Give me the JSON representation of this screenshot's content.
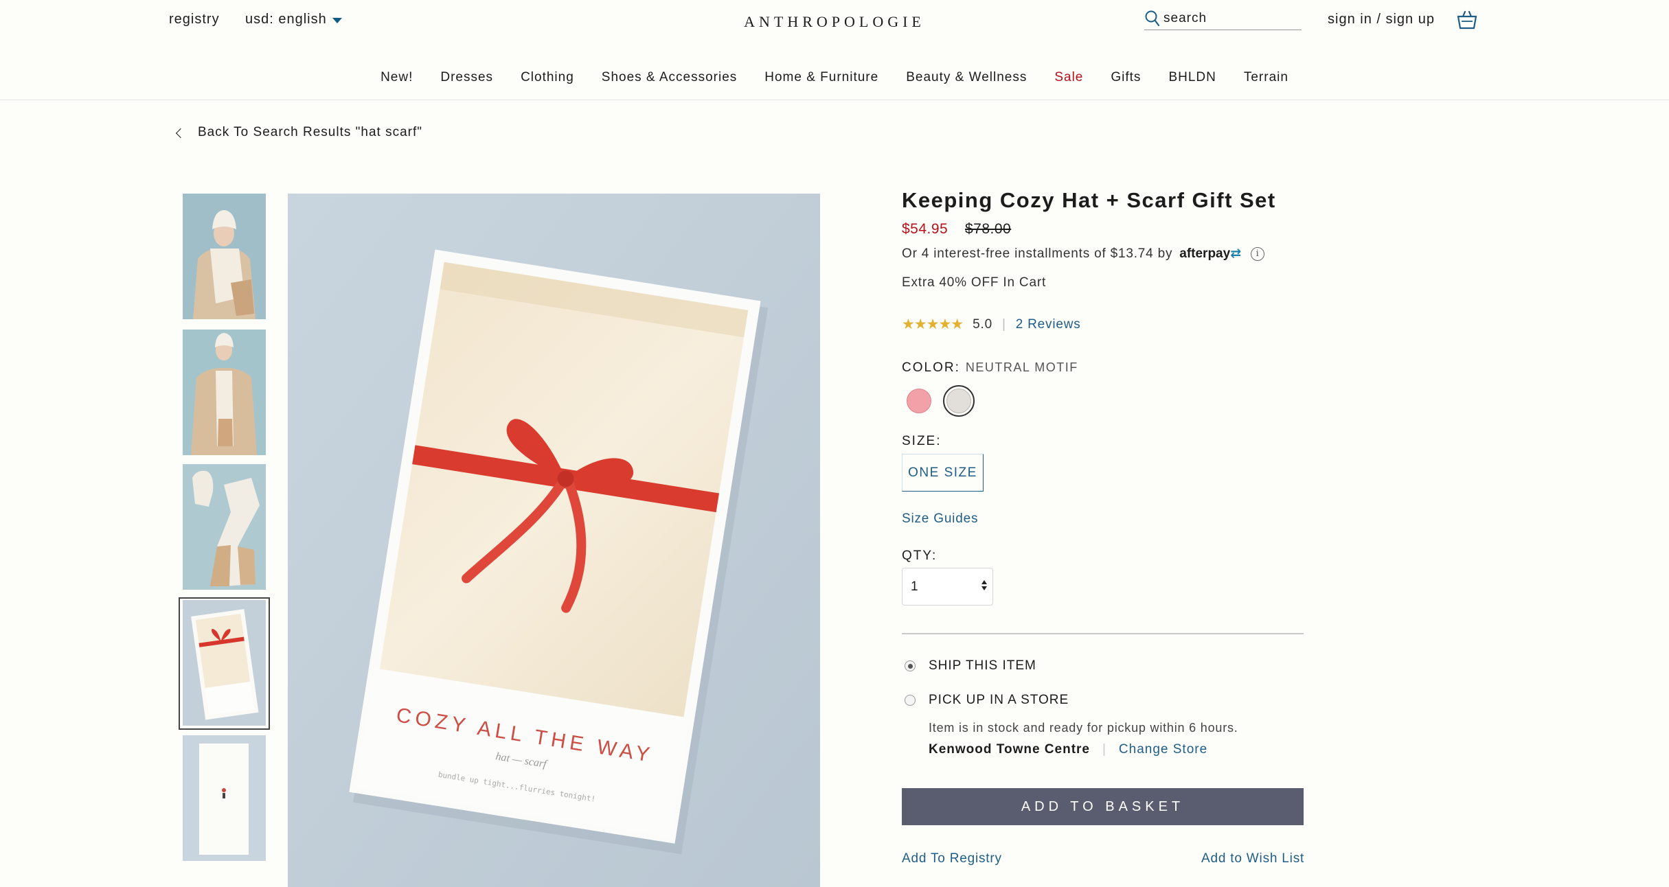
{
  "header": {
    "registry": "registry",
    "currency": "usd: english",
    "logo": "ANTHROPOLOGIE",
    "search_placeholder": "search",
    "sign_in": "sign in / sign up"
  },
  "nav": {
    "items": [
      "New!",
      "Dresses",
      "Clothing",
      "Shoes & Accessories",
      "Home & Furniture",
      "Beauty & Wellness",
      "Sale",
      "Gifts",
      "BHLDN",
      "Terrain"
    ]
  },
  "breadcrumb": {
    "back_text": "Back To Search Results \"hat scarf\""
  },
  "gallery": {
    "selected_index": 3,
    "packaging_text_top": "COZY ALL THE WAY",
    "packaging_text_mid": "hat — scarf",
    "packaging_text_bottom": "bundle up tight...flurries tonight!"
  },
  "product": {
    "title": "Keeping Cozy Hat + Scarf Gift Set",
    "sale_price": "$54.95",
    "original_price": "$78.00",
    "installments_text": "Or 4 interest-free installments of $13.74 by",
    "afterpay_brand": "afterpay",
    "promo": "Extra 40% OFF In Cart",
    "rating_value": "5.0",
    "rating_stars": 5,
    "reviews_link": "2 Reviews",
    "color_label": "COLOR:",
    "color_value": "NEUTRAL MOTIF",
    "size_label": "SIZE:",
    "size_option": "ONE SIZE",
    "size_guides": "Size Guides",
    "qty_label": "QTY:",
    "qty_value": "1",
    "ship_label": "SHIP THIS ITEM",
    "pickup_label": "PICK UP IN A STORE",
    "stock_text": "Item is in stock and ready for pickup within 6 hours.",
    "store_name": "Kenwood Towne Centre",
    "change_store": "Change Store",
    "add_to_basket": "ADD TO BASKET",
    "add_to_registry": "Add To Registry",
    "add_to_wishlist": "Add to Wish List"
  },
  "colors": {
    "accent_link": "#1f5d86",
    "sale_red": "#b5121b",
    "button_bg": "#5a5d70",
    "star": "#e3b02f"
  }
}
